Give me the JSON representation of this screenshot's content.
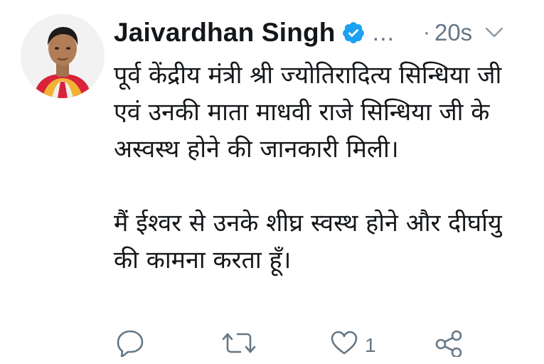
{
  "tweet": {
    "display_name": "Jaivardhan Singh",
    "handle_truncated": "...",
    "separator": "·",
    "timestamp": "20s",
    "verified": true,
    "text_paragraph_1": "पूर्व केंद्रीय मंत्री श्री ज्योतिरादित्य सिन्धिया जी एवं उनकी माता माधवी राजे सिन्धिया जी के अस्वस्थ होने की जानकारी मिली।",
    "text_paragraph_2": "मैं ईश्वर से उनके शीघ्र स्वस्थ होने और दीर्घायु की कामना करता हूँ।",
    "like_count": "1"
  },
  "colors": {
    "text_primary": "#14171a",
    "text_secondary": "#657786",
    "verified_blue": "#1da1f2",
    "background": "#ffffff"
  },
  "icons": {
    "reply": "reply-icon",
    "retweet": "retweet-icon",
    "like": "heart-icon",
    "share": "share-icon",
    "more": "chevron-down-icon",
    "verified": "verified-badge-icon"
  }
}
